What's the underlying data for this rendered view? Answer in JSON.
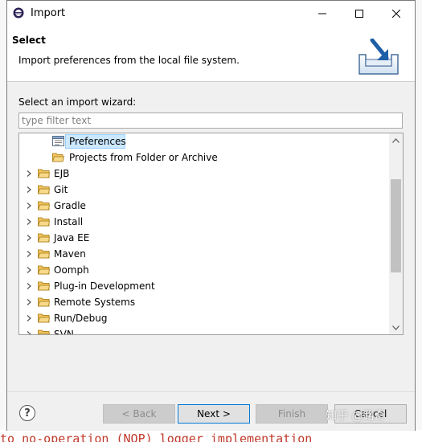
{
  "window": {
    "title": "Import",
    "controls": [
      "minimize-icon",
      "maximize-icon",
      "close-icon"
    ]
  },
  "header": {
    "title": "Select",
    "description": "Import preferences from the local file system.",
    "graphic": "import-wizard-icon"
  },
  "wizard": {
    "label": "Select an import wizard:",
    "filter_placeholder": "type filter text",
    "filter_value": ""
  },
  "tree": {
    "children_of_general": [
      {
        "label": "Preferences",
        "icon": "preferences-icon",
        "selected": true
      },
      {
        "label": "Projects from Folder or Archive",
        "icon": "folder-open-icon",
        "selected": false
      }
    ],
    "categories": [
      {
        "label": "EJB"
      },
      {
        "label": "Git"
      },
      {
        "label": "Gradle"
      },
      {
        "label": "Install"
      },
      {
        "label": "Java EE"
      },
      {
        "label": "Maven"
      },
      {
        "label": "Oomph"
      },
      {
        "label": "Plug-in Development"
      },
      {
        "label": "Remote Systems"
      },
      {
        "label": "Run/Debug"
      },
      {
        "label": "SVN"
      }
    ]
  },
  "buttons": {
    "help": "?",
    "back": "< Back",
    "next": "Next >",
    "finish": "Finish",
    "cancel": "Cancel"
  },
  "watermark": "知乎 @路奇",
  "background": {
    "bottom_text": "to no-operation (NOP) logger implementation"
  },
  "colors": {
    "selection": "#cce8ff",
    "default_button_border": "#0078d7",
    "folder": "#e8b84a"
  }
}
